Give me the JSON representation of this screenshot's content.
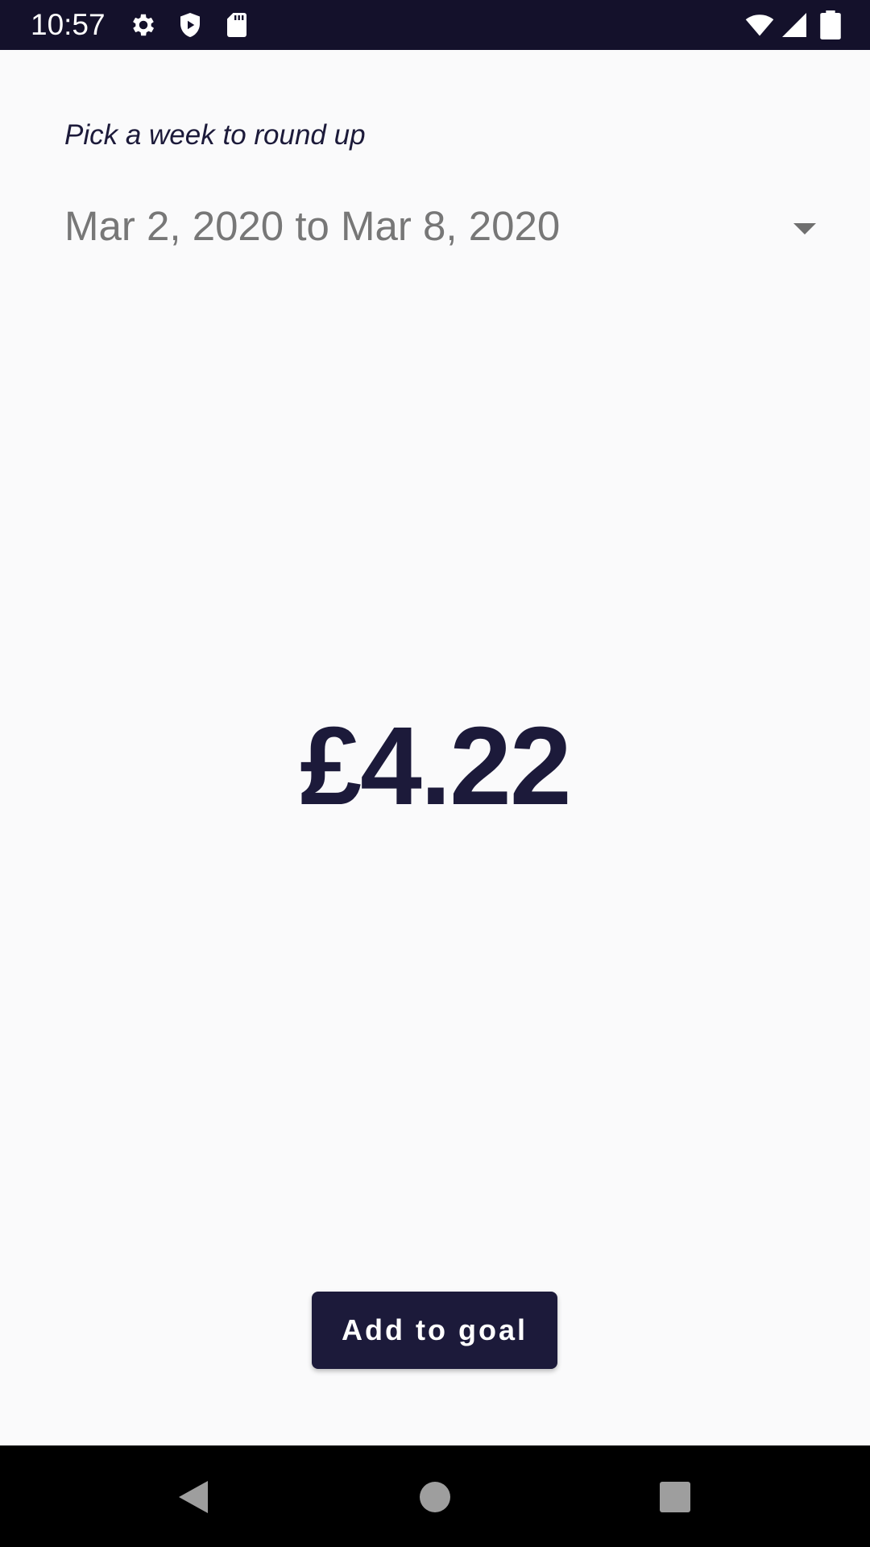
{
  "status_bar": {
    "time": "10:57",
    "icons_left": [
      "gear-icon",
      "shield-icon",
      "sd-card-icon"
    ],
    "icons_right": [
      "wifi-icon",
      "signal-icon",
      "battery-icon"
    ]
  },
  "content": {
    "prompt_label": "Pick a week to round up",
    "week_select": {
      "value": "Mar 2, 2020 to Mar 8, 2020"
    },
    "amount": "£4.22",
    "add_button_label": "Add to goal"
  },
  "nav_bar": {
    "buttons": [
      "back-icon",
      "home-icon",
      "recents-icon"
    ]
  },
  "colors": {
    "status_bar_bg": "#14112b",
    "primary_text": "#1c1a3a",
    "secondary_text": "#777777",
    "button_bg": "#1c1a3a",
    "background": "#fafafb",
    "nav_bar_bg": "#000000"
  }
}
